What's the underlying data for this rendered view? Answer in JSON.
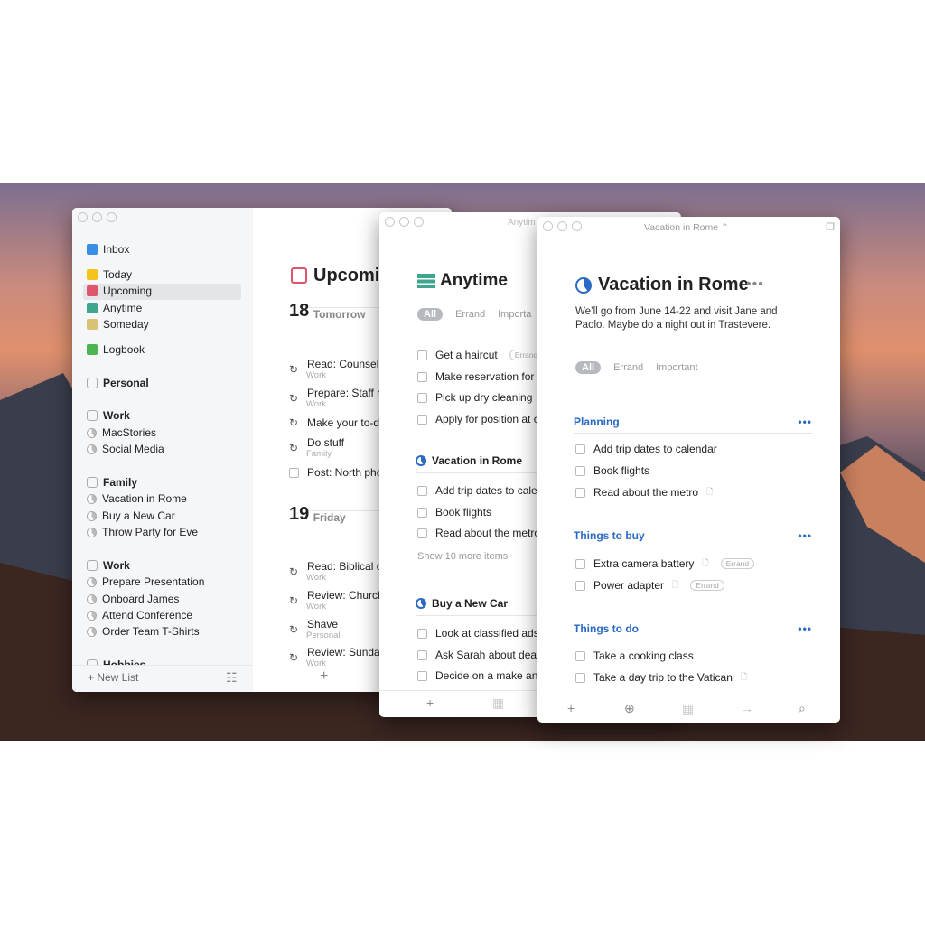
{
  "sidebar": {
    "items": [
      {
        "label": "Inbox",
        "icon": "inbox-icon",
        "color": "#3a8ee6"
      },
      {
        "label": "Today",
        "icon": "star-icon",
        "color": "#f5c21b"
      },
      {
        "label": "Upcoming",
        "icon": "calendar-icon",
        "color": "#e0546c",
        "selected": true
      },
      {
        "label": "Anytime",
        "icon": "layers-icon",
        "color": "#3fa58f"
      },
      {
        "label": "Someday",
        "icon": "archive-box-icon",
        "color": "#d8c273"
      },
      {
        "label": "Logbook",
        "icon": "logbook-icon",
        "color": "#4cb552"
      },
      {
        "label": "Personal",
        "icon": "area-icon"
      },
      {
        "label": "Work",
        "icon": "area-icon"
      },
      {
        "label": "MacStories",
        "icon": "project-pie-icon"
      },
      {
        "label": "Social Media",
        "icon": "project-pie-icon"
      },
      {
        "label": "Family",
        "icon": "area-icon"
      },
      {
        "label": "Vacation in Rome",
        "icon": "project-pie-icon"
      },
      {
        "label": "Buy a New Car",
        "icon": "project-pie-icon"
      },
      {
        "label": "Throw Party for Eve",
        "icon": "project-pie-icon"
      },
      {
        "label": "Work",
        "icon": "area-icon"
      },
      {
        "label": "Prepare Presentation",
        "icon": "project-pie-icon"
      },
      {
        "label": "Onboard James",
        "icon": "project-pie-icon"
      },
      {
        "label": "Attend Conference",
        "icon": "project-pie-icon"
      },
      {
        "label": "Order Team T-Shirts",
        "icon": "project-pie-icon"
      },
      {
        "label": "Hobbies",
        "icon": "area-icon"
      }
    ],
    "new_list": "New List"
  },
  "upcoming": {
    "title": "Upcoming",
    "days": [
      {
        "num": "18",
        "name": "Tomorrow",
        "tasks": [
          {
            "t": "Read: Counseli",
            "s": "Work"
          },
          {
            "t": "Prepare: Staff r",
            "s": "Work"
          },
          {
            "t": "Make your to-d",
            "s": ""
          },
          {
            "t": "Do stuff",
            "s": "Family"
          },
          {
            "t": "Post: North pho",
            "s": "",
            "checkbox": true
          }
        ]
      },
      {
        "num": "19",
        "name": "Friday",
        "tasks": [
          {
            "t": "Read: Biblical c",
            "s": "Work"
          },
          {
            "t": "Review: Church",
            "s": "Work"
          },
          {
            "t": "Shave",
            "s": "Personal"
          },
          {
            "t": "Review: Sunday",
            "s": "Work"
          }
        ]
      }
    ]
  },
  "anytime": {
    "window_title": "Anytim",
    "title": "Anytime",
    "filters": [
      "All",
      "Errand",
      "Importa"
    ],
    "tasks": [
      {
        "t": "Get a haircut",
        "tag": "Errand"
      },
      {
        "t": "Make reservation for"
      },
      {
        "t": "Pick up dry cleaning"
      },
      {
        "t": "Apply for position at c"
      }
    ],
    "projects": [
      {
        "name": "Vacation in Rome",
        "tasks": [
          "Add trip dates to cale",
          "Book flights",
          "Read about the metro"
        ],
        "more": "Show 10 more items"
      },
      {
        "name": "Buy a New Car",
        "tasks": [
          "Look at classified ads",
          "Ask Sarah about deal",
          "Decide on a make and"
        ]
      }
    ]
  },
  "rome": {
    "window_title": "Vacation in Rome ⌃",
    "title": "Vacation in Rome",
    "notes": [
      "We’ll go from June 14-22 and visit Jane and",
      "Paolo. Maybe do a night out in Trastevere."
    ],
    "filters": [
      "All",
      "Errand",
      "Important"
    ],
    "headings": [
      {
        "name": "Planning",
        "tasks": [
          {
            "t": "Add trip dates to calendar"
          },
          {
            "t": "Book flights"
          },
          {
            "t": "Read about the metro",
            "note": true
          }
        ]
      },
      {
        "name": "Things to buy",
        "tasks": [
          {
            "t": "Extra camera battery",
            "note": true,
            "tag": "Errand"
          },
          {
            "t": "Power adapter",
            "note": true,
            "tag": "Errand"
          }
        ]
      },
      {
        "name": "Things to do",
        "tasks": [
          {
            "t": "Take a cooking class"
          },
          {
            "t": "Take a day trip to the Vatican",
            "note": true
          }
        ]
      }
    ]
  },
  "colors": {
    "accent": "#2a6ac4",
    "sidebar_bg": "#f5f6f8"
  }
}
